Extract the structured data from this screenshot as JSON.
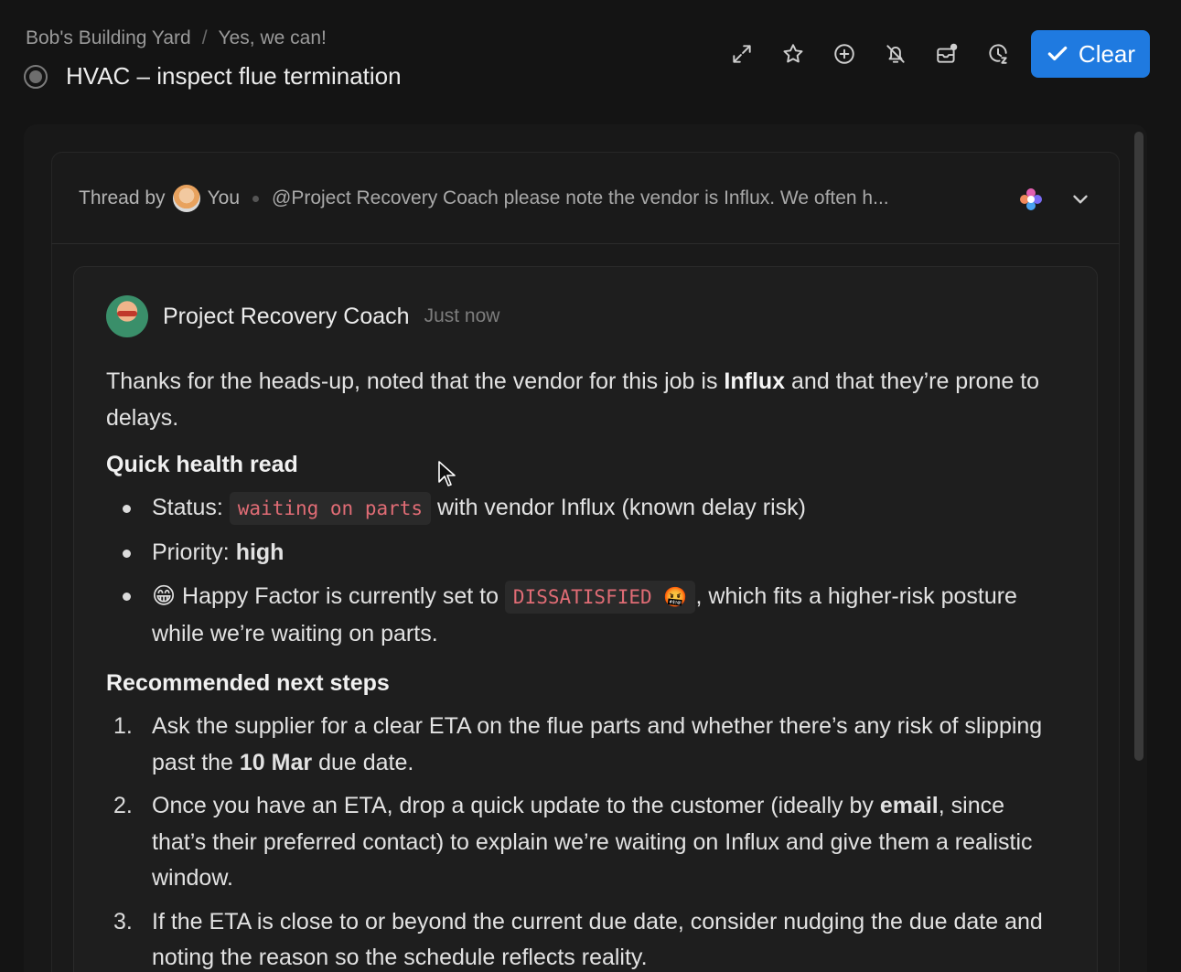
{
  "header": {
    "breadcrumb": [
      "Bob's Building Yard",
      "/",
      "Yes, we can!"
    ],
    "title": "HVAC – inspect flue termination"
  },
  "toolbar": {
    "icons": [
      "expand-icon",
      "star-icon",
      "add-circle-icon",
      "bell-off-icon",
      "inbox-icon",
      "snooze-clock-icon"
    ],
    "clear_label": "Clear",
    "accent": "#1f7ae0"
  },
  "thread": {
    "by_label": "Thread by",
    "author": "You",
    "preview": "@Project Recovery Coach please note the vendor is Influx. We often h..."
  },
  "message": {
    "author": "Project Recovery Coach",
    "timestamp": "Just now",
    "intro_a": "Thanks for the heads-up, noted that the vendor for this job is ",
    "intro_bold": "Influx",
    "intro_b": " and that they’re prone to delays.",
    "heading_health": "Quick health read",
    "status_label": "Status: ",
    "status_code": "waiting on parts",
    "status_tail": " with vendor Influx (known delay risk)",
    "priority_label": "Priority: ",
    "priority_value": "high",
    "happy_emoji": "😁",
    "happy_a": " Happy Factor is currently set to ",
    "happy_code": "DISSATISFIED 🤬",
    "happy_b": ", which fits a higher-risk posture while we’re waiting on parts.",
    "heading_steps": "Recommended next steps",
    "steps": [
      {
        "num": "1.",
        "a": "Ask the supplier for a clear ETA on the flue parts and whether there’s any risk of slipping past the ",
        "bold": "10 Mar",
        "b": " due date."
      },
      {
        "num": "2.",
        "a": "Once you have an ETA, drop a quick update to the customer (ideally by ",
        "bold": "email",
        "b": ", since that’s their preferred contact) to explain we’re waiting on Influx and give them a realistic window."
      },
      {
        "num": "3.",
        "a": "If the ETA is close to or beyond the current due date, consider nudging the due date and noting the reason so the schedule reflects reality.",
        "bold": "",
        "b": ""
      }
    ]
  }
}
